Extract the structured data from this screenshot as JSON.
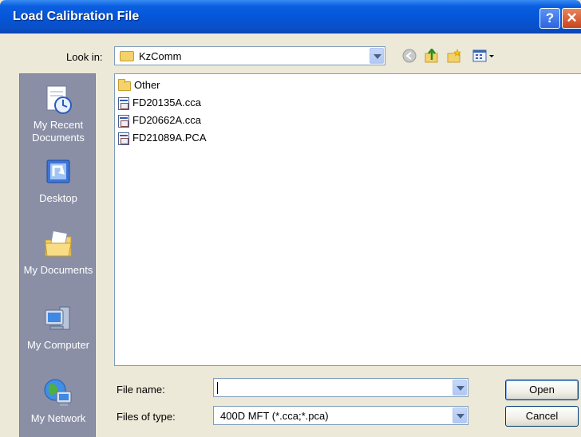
{
  "window": {
    "title": "Load Calibration File"
  },
  "titlebar": {
    "help_label": "?",
    "close_label": "✕"
  },
  "lookin": {
    "label": "Look in:",
    "value": "KzComm"
  },
  "toolbar": {
    "icons": [
      "back-icon",
      "up-folder-icon",
      "new-folder-icon",
      "views-icon"
    ]
  },
  "places": [
    {
      "name": "My Recent Documents",
      "label_line1": "My Recent",
      "label_line2": "Documents",
      "icon": "recent-documents-icon"
    },
    {
      "name": "Desktop",
      "label_line1": "Desktop",
      "icon": "desktop-icon"
    },
    {
      "name": "My Documents",
      "label_line1": "My Documents",
      "icon": "my-documents-icon"
    },
    {
      "name": "My Computer",
      "label_line1": "My Computer",
      "icon": "my-computer-icon"
    },
    {
      "name": "My Network",
      "label_line1": "My Network",
      "icon": "my-network-icon"
    }
  ],
  "files": [
    {
      "name": "Other",
      "type": "folder"
    },
    {
      "name": "FD20135A.cca",
      "type": "file"
    },
    {
      "name": "FD20662A.cca",
      "type": "file"
    },
    {
      "name": "FD21089A.PCA",
      "type": "file"
    }
  ],
  "filename": {
    "label": "File name:",
    "value": ""
  },
  "filetype": {
    "label": "Files of type:",
    "value": "400D MFT (*.cca;*.pca)"
  },
  "buttons": {
    "open": "Open",
    "cancel": "Cancel"
  }
}
